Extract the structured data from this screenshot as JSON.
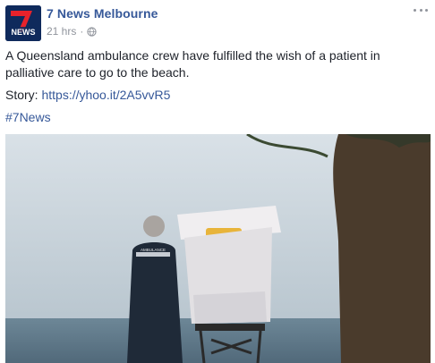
{
  "post": {
    "author": "7 News Melbourne",
    "avatar_text": "NEWS",
    "timestamp": "21 hrs",
    "separator": "·",
    "audience_icon": "globe-icon",
    "menu_icon": "more-options-icon",
    "body_line": "A Queensland ambulance crew have fulfilled the wish of a patient in palliative care to go to the beach.",
    "story_label": "Story:",
    "story_link": "https://yhoo.it/2A5vvR5",
    "hashtag": "#7News"
  },
  "photo": {
    "uniform_text": "AMBULANCE",
    "colors": {
      "sky": "#c9d3db",
      "sea": "#5f7a8a",
      "tree": "#4a3b2c",
      "uniform": "#1f2a38"
    }
  },
  "colors": {
    "link": "#365899",
    "meta": "#90949c",
    "text": "#1d2129",
    "brand": "#0f2a5c"
  }
}
